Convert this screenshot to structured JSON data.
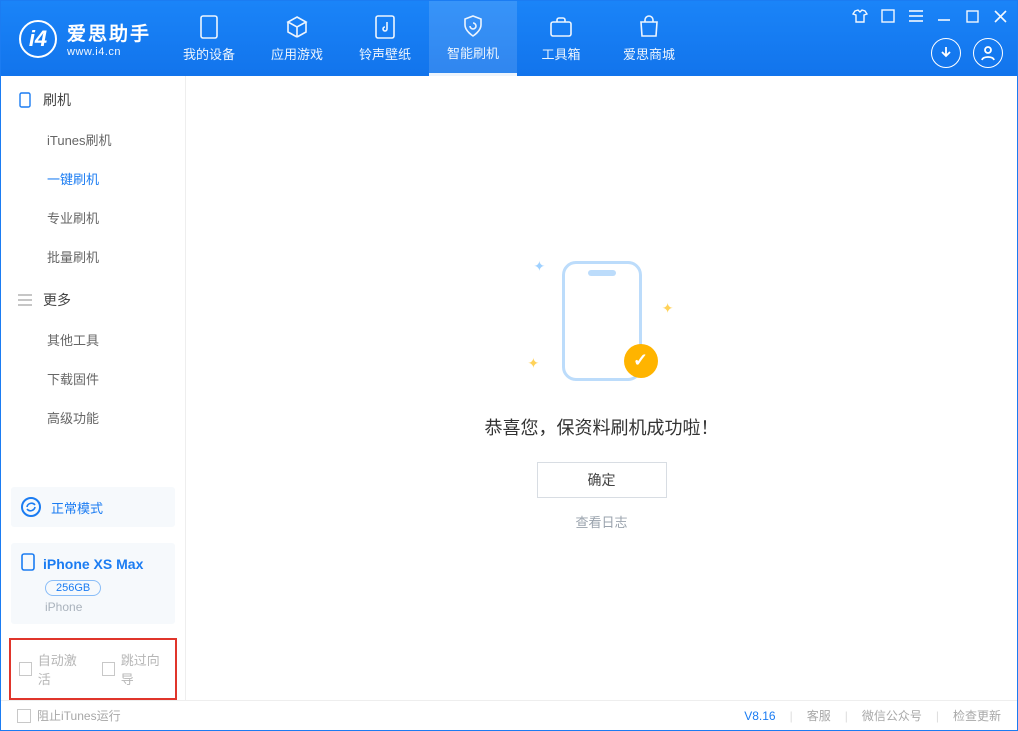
{
  "brand": {
    "name": "爱思助手",
    "url": "www.i4.cn"
  },
  "tabs": [
    {
      "label": "我的设备"
    },
    {
      "label": "应用游戏"
    },
    {
      "label": "铃声壁纸"
    },
    {
      "label": "智能刷机"
    },
    {
      "label": "工具箱"
    },
    {
      "label": "爱思商城"
    }
  ],
  "sidebar": {
    "sections": [
      {
        "title": "刷机",
        "items": [
          "iTunes刷机",
          "一键刷机",
          "专业刷机",
          "批量刷机"
        ],
        "activeIndex": 1
      },
      {
        "title": "更多",
        "items": [
          "其他工具",
          "下载固件",
          "高级功能"
        ],
        "activeIndex": -1
      }
    ],
    "mode": {
      "label": "正常模式"
    },
    "device": {
      "name": "iPhone XS Max",
      "capacity": "256GB",
      "type": "iPhone"
    },
    "options": {
      "autoActivate": "自动激活",
      "skipGuide": "跳过向导"
    }
  },
  "main": {
    "success_message": "恭喜您，保资料刷机成功啦！",
    "ok_label": "确定",
    "log_label": "查看日志"
  },
  "footer": {
    "blockItunes": "阻止iTunes运行",
    "version": "V8.16",
    "links": [
      "客服",
      "微信公众号",
      "检查更新"
    ]
  }
}
